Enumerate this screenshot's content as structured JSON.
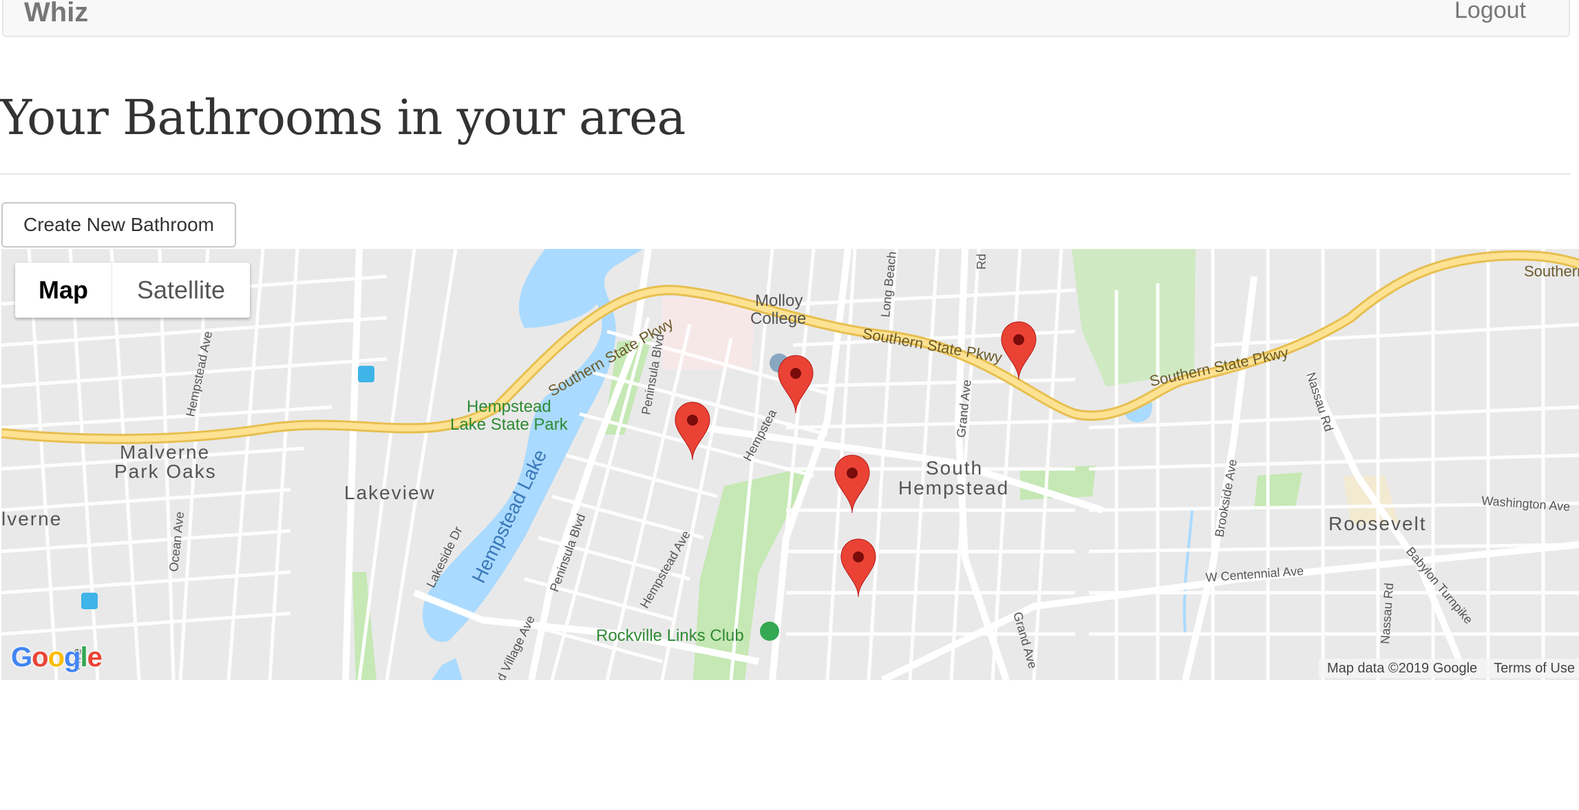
{
  "navbar": {
    "brand": "Whiz",
    "logout_label": "Logout"
  },
  "page": {
    "title": "Your Bathrooms in your area",
    "create_button_label": "Create New Bathroom"
  },
  "map": {
    "type_control": {
      "map_label": "Map",
      "satellite_label": "Satellite",
      "selected": "Map"
    },
    "attribution": "Map data ©2019 Google",
    "terms_label": "Terms of Use",
    "logo_text": "Google",
    "marker_count": 5,
    "marker_color": "#ea4335",
    "labels": {
      "southern_state_pkwy": "Southern State Pkwy",
      "southern_edge": "Southern",
      "molloy_1": "Molloy",
      "molloy_2": "College",
      "hempstead_lake_park_1": "Hempstead",
      "hempstead_lake_park_2": "Lake State Park",
      "hempstead_lake": "Hempstead Lake",
      "malverne_1": "Malverne",
      "malverne_2": "Park Oaks",
      "lakeview": "Lakeview",
      "malverne_edge": "lverne",
      "south_hempstead_1": "South",
      "south_hempstead_2": "Hempstead",
      "roosevelt": "Roosevelt",
      "rockville_links": "Rockville Links Club",
      "hempstead_ave": "Hempstead Ave",
      "peninsula_blvd": "Peninsula Blvd",
      "lakeside_dr": "Lakeside Dr",
      "ocean_ave": "Ocean Ave",
      "grand_ave": "Grand Ave",
      "long_beach": "Long Beach",
      "nassau_rd": "Nassau Rd",
      "brookside_ave": "Brookside Ave",
      "washington_ave": "Washington Ave",
      "w_centennial_ave": "W Centennial Ave",
      "babylon_turnpike": "Babylon Turnpike",
      "village_ave": "d Village Ave",
      "hempstea": "Hempstea",
      "rd": "Rd",
      "ave_fragment": "Ave"
    },
    "colors": {
      "land": "#e9e9e9",
      "road": "#ffffff",
      "highway": "#f6d77a",
      "water": "#aadaff",
      "park": "#c5e8b4",
      "campus": "#f7e8e8"
    }
  }
}
